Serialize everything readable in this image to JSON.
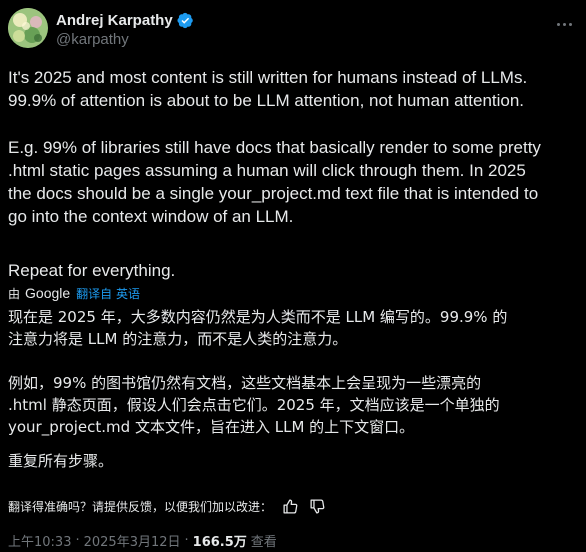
{
  "author": {
    "display_name": "Andrej Karpathy",
    "handle": "@karpathy",
    "verified": true
  },
  "tweet": {
    "paragraph_1": "It's 2025 and most content is still written for humans instead of LLMs.\n99.9% of attention is about to be LLM attention, not human attention.",
    "paragraph_2": "E.g. 99% of libraries still have docs that basically render to some pretty\n.html static pages assuming a human will click through them. In 2025\nthe docs should be a single your_project.md text file that is intended to\ngo into the context window of an LLM.",
    "paragraph_3": "Repeat for everything."
  },
  "translation": {
    "by_label": "由",
    "provider": "Google",
    "link_label": "翻译自 英语",
    "paragraph_1": "现在是 2025 年，大多数内容仍然是为人类而不是 LLM 编写的。99.9% 的\n注意力将是 LLM 的注意力，而不是人类的注意力。",
    "paragraph_2": "例如，99% 的图书馆仍然有文档，这些文档基本上会呈现为一些漂亮的\n.html 静态页面，假设人们会点击它们。2025 年，文档应该是一个单独的\nyour_project.md 文本文件，旨在进入 LLM 的上下文窗口。",
    "paragraph_3": "重复所有步骤。",
    "feedback_prompt": "翻译得准确吗？请提供反馈，以便我们加以改进："
  },
  "meta": {
    "time": "上午10:33",
    "date": "2025年3月12日",
    "views": "166.5万",
    "views_label": "查看",
    "separator": "·"
  },
  "colors": {
    "background": "#000000",
    "text": "#e7e9ea",
    "secondary": "#71767b",
    "accent": "#1d9bf0"
  }
}
